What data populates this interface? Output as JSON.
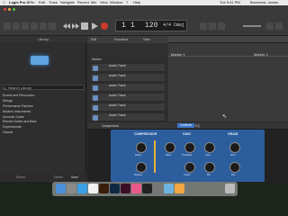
{
  "menubar": {
    "app": "Logic Pro X",
    "items": [
      "File",
      "Edit",
      "Track",
      "Navigate",
      "Record",
      "Mix",
      "View",
      "Window",
      "?",
      "Help"
    ],
    "clock": "Tue 9:41 PM",
    "user": "Bouchard, James"
  },
  "lcd": {
    "bar": "1",
    "beat": "1",
    "tempo": "120",
    "key": "Cmaj",
    "sig": "4/4"
  },
  "toolbar": {
    "edit_label": "Edit",
    "functions_label": "Functions",
    "view_label": "View"
  },
  "library": {
    "title": "Library",
    "search_placeholder": "Search Library",
    "items": [
      "Drums and Percussion",
      "Strings",
      "Performance Patches",
      "Modern Instruments",
      "Acoustic Guitar",
      "Electric Guitar and Bass",
      "Experimental",
      "Classic"
    ],
    "footer_revert": "Revert",
    "footer_delete": "Delete",
    "footer_save": "Save"
  },
  "tracks": {
    "header": "Marker",
    "items": [
      "Audio Track",
      "Audio Track",
      "Audio Track",
      "Audio Track",
      "Audio Track",
      "Audio Track"
    ]
  },
  "arrange": {
    "markers": [
      "Marker 1",
      "Marker 2"
    ]
  },
  "smart_controls": {
    "title": "Compressor",
    "tab_controls": "Controls",
    "tab_eq": "EQ",
    "sections": [
      "COMPRESSOR",
      "GAIN",
      "GRAIN"
    ],
    "labels": [
      "Attack",
      "Release",
      "Ratio",
      "Threshold",
      "Input",
      "Output",
      "Drive",
      "Mix",
      "Wet",
      "Dry"
    ]
  },
  "colors": {
    "plugin_blue": "#2c5e9e",
    "patch_glow": "#5fa3e0",
    "record_red": "#d03a2a"
  },
  "dock": {
    "icons": [
      "finder-icon",
      "launchpad-icon",
      "safari-icon",
      "calendar-icon",
      "illustrator-icon",
      "photoshop-icon",
      "indesign-icon",
      "music-icon",
      "logic-icon",
      "settings-icon",
      "preview-icon",
      "photos-icon",
      "trash-icon"
    ]
  }
}
